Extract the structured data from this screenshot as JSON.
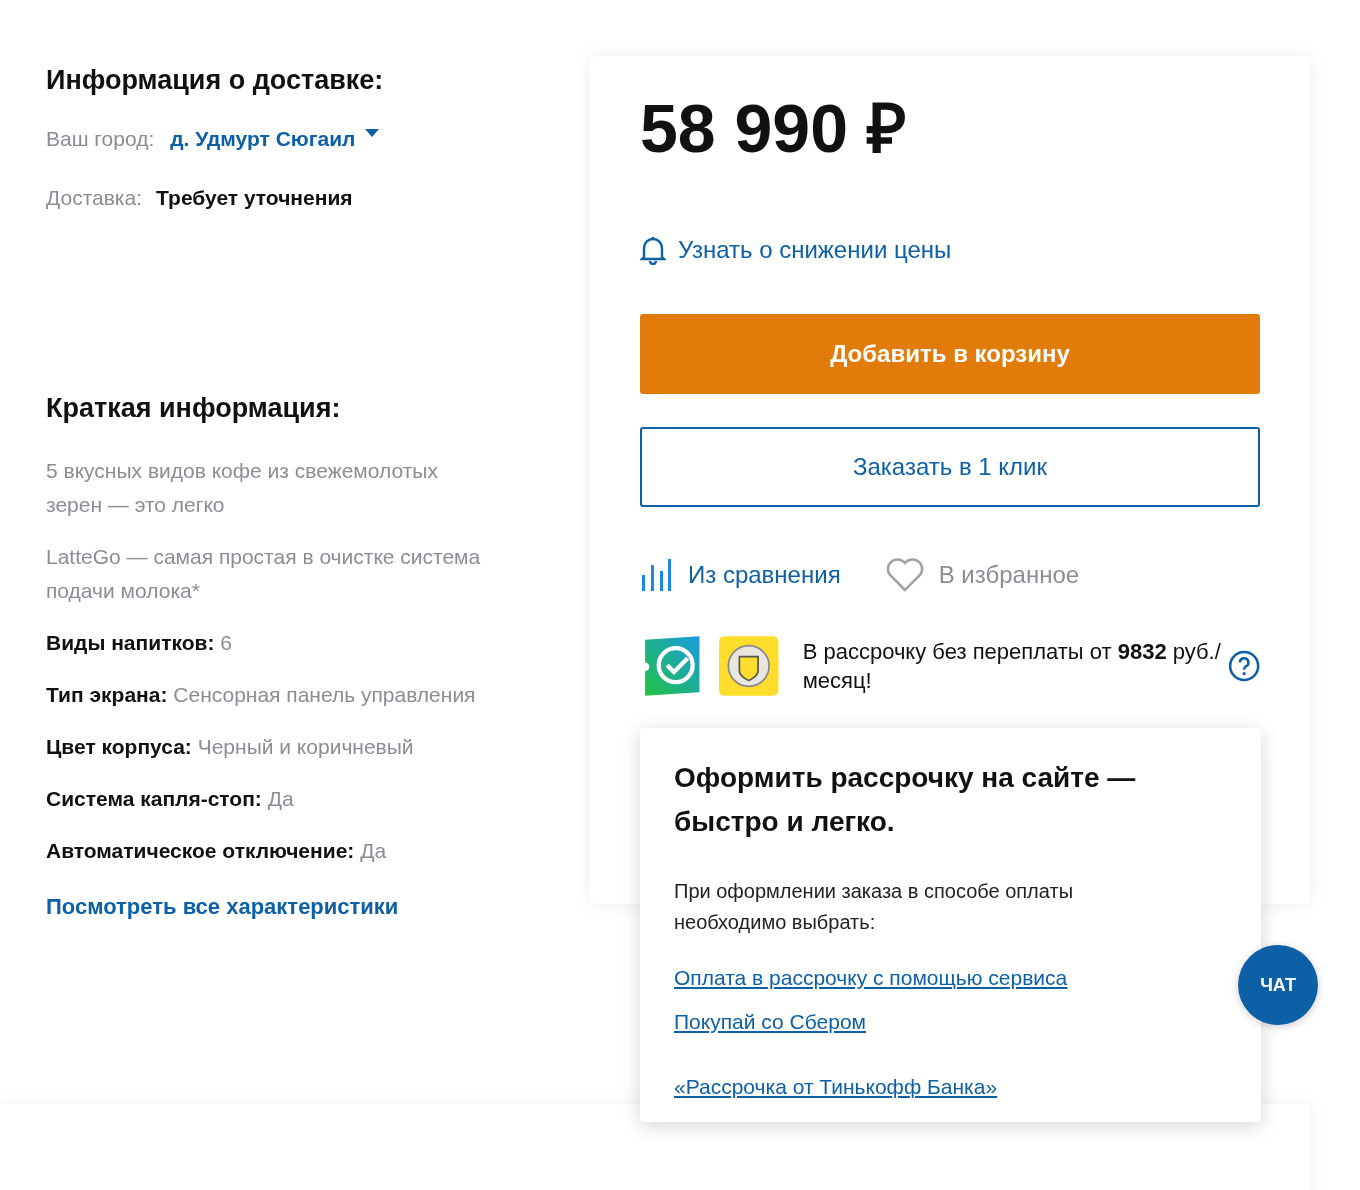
{
  "delivery": {
    "title": "Информация о доставке:",
    "city_label": "Ваш город:",
    "city": "д. Удмурт Сюгаил",
    "delivery_label": "Доставка:",
    "delivery_value": "Требует уточнения"
  },
  "short_info": {
    "title": "Краткая информация:",
    "items": [
      {
        "kind": "text",
        "text": "5 вкусных видов кофе из свежемолотых зерен — это легко"
      },
      {
        "kind": "text",
        "text": "LatteGo — самая простая в очистке система подачи молока*"
      },
      {
        "kind": "spec",
        "label": "Виды напитков:",
        "value": "6"
      },
      {
        "kind": "spec",
        "label": "Тип экрана:",
        "value": "Сенсорная панель управления"
      },
      {
        "kind": "spec",
        "label": "Цвет корпуса:",
        "value": "Черный и коричневый"
      },
      {
        "kind": "spec",
        "label": "Система капля-стоп:",
        "value": "Да"
      },
      {
        "kind": "spec",
        "label": "Автоматическое отключение:",
        "value": "Да"
      }
    ],
    "link": "Посмотреть все характеристики"
  },
  "buy": {
    "price": "58 990 ₽",
    "price_alert": "Узнать о снижении цены",
    "add_to_cart": "Добавить в корзину",
    "one_click": "Заказать в 1 клик",
    "compare": {
      "label": "Из сравнения",
      "selected": true
    },
    "favorite": {
      "label": "В избранное",
      "selected": false
    },
    "installment": "В рассрочку без переплаты от **9832** руб./ месяц!"
  },
  "popover": {
    "title": "Оформить рассрочку на сайте — быстро и легко.",
    "text": "При оформлении заказа в способе оплаты необходимо выбрать:",
    "links": [
      "Оплата в рассрочку с помощью сервиса",
      "Покупай со Сбером",
      "«Рассрочка от Тинькофф Банка»"
    ]
  },
  "chat": "ЧАТ"
}
